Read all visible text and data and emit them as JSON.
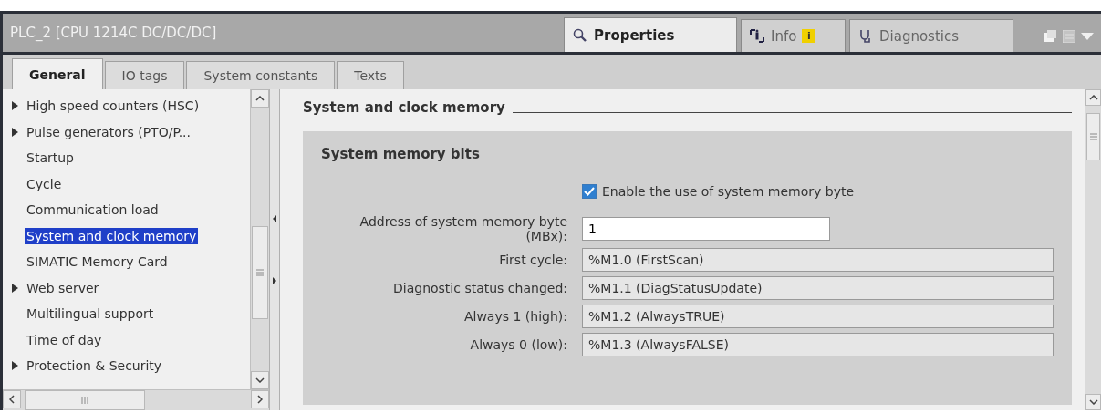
{
  "window": {
    "title": "PLC_2 [CPU 1214C DC/DC/DC]"
  },
  "inspector_tabs": [
    {
      "label": "Properties",
      "selected": true,
      "kind": "properties"
    },
    {
      "label": "Info",
      "selected": false,
      "kind": "info",
      "badge": "i"
    },
    {
      "label": "Diagnostics",
      "selected": false,
      "kind": "diagnostics"
    }
  ],
  "tabs": [
    {
      "label": "General",
      "selected": true
    },
    {
      "label": "IO tags",
      "selected": false
    },
    {
      "label": "System constants",
      "selected": false
    },
    {
      "label": "Texts",
      "selected": false
    }
  ],
  "sidebar": {
    "items": [
      {
        "label": "High speed counters (HSC)",
        "kind": "group",
        "expanded": false,
        "selected": false
      },
      {
        "label": "Pulse generators (PTO/P...",
        "kind": "group",
        "expanded": false,
        "selected": false
      },
      {
        "label": "Startup",
        "kind": "item",
        "selected": false
      },
      {
        "label": "Cycle",
        "kind": "item",
        "selected": false
      },
      {
        "label": "Communication load",
        "kind": "item",
        "selected": false
      },
      {
        "label": "System and clock memory",
        "kind": "item",
        "selected": true
      },
      {
        "label": "SIMATIC Memory Card",
        "kind": "item",
        "selected": false
      },
      {
        "label": "Web server",
        "kind": "group",
        "expanded": false,
        "selected": false
      },
      {
        "label": "Multilingual support",
        "kind": "item",
        "selected": false
      },
      {
        "label": "Time of day",
        "kind": "item",
        "selected": false
      },
      {
        "label": "Protection & Security",
        "kind": "group",
        "expanded": false,
        "selected": false
      }
    ]
  },
  "content": {
    "heading": "System and clock memory",
    "section": {
      "title": "System memory bits",
      "checkbox": {
        "label": "Enable the use of system memory byte",
        "checked": true
      },
      "address": {
        "label": "Address of system memory byte (MBx):",
        "value": "1"
      },
      "rows": [
        {
          "label": "First cycle:",
          "value": "%M1.0 (FirstScan)"
        },
        {
          "label": "Diagnostic status changed:",
          "value": "%M1.1 (DiagStatusUpdate)"
        },
        {
          "label": "Always 1 (high):",
          "value": "%M1.2 (AlwaysTRUE)"
        },
        {
          "label": "Always 0 (low):",
          "value": "%M1.3 (AlwaysFALSE)"
        }
      ]
    }
  }
}
